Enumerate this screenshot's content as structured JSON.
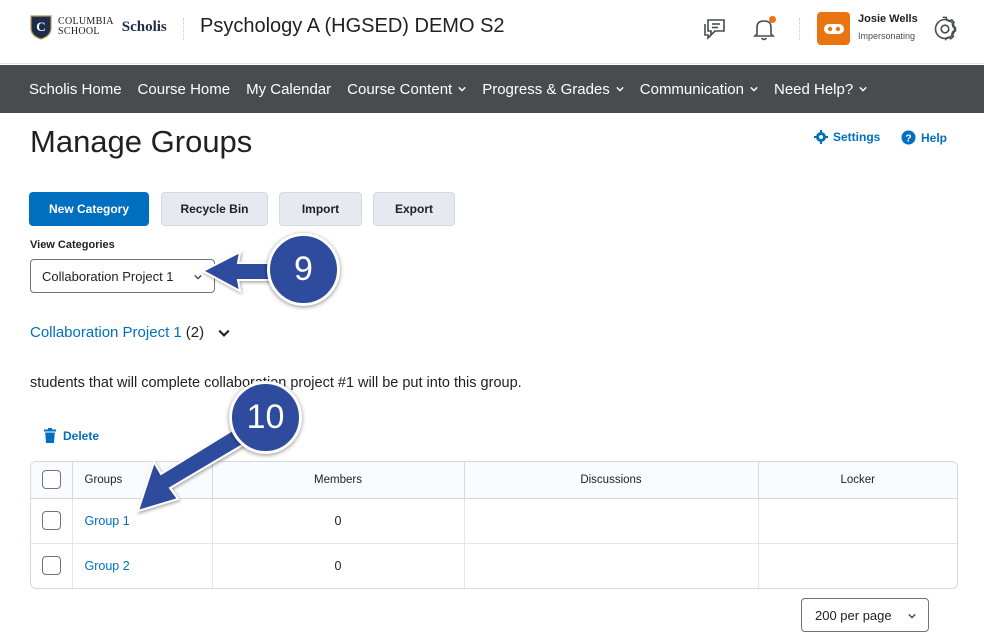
{
  "header": {
    "logo_line1": "COLUMBIA",
    "logo_line2": "SCHOOL",
    "logo_brand": "Scholis",
    "course_title": "Psychology A (HGSED) DEMO S2",
    "user_name": "Josie Wells",
    "user_role": "Impersonating",
    "icons": [
      "message-alerts-icon",
      "notifications-bell-icon",
      "impersonation-mask-icon",
      "settings-gear-icon"
    ],
    "notification_dot_color": "#e87511"
  },
  "nav": {
    "items": [
      {
        "label": "Scholis Home",
        "dropdown": false
      },
      {
        "label": "Course Home",
        "dropdown": false
      },
      {
        "label": "My Calendar",
        "dropdown": false
      },
      {
        "label": "Course Content",
        "dropdown": true
      },
      {
        "label": "Progress & Grades",
        "dropdown": true
      },
      {
        "label": "Communication",
        "dropdown": true
      },
      {
        "label": "Need Help?",
        "dropdown": true
      }
    ]
  },
  "page": {
    "title": "Manage Groups",
    "settings_label": "Settings",
    "help_label": "Help"
  },
  "buttons": {
    "new_category": "New Category",
    "recycle_bin": "Recycle Bin",
    "import": "Import",
    "export": "Export"
  },
  "view_categories": {
    "label": "View Categories",
    "selected": "Collaboration Project 1"
  },
  "category": {
    "name": "Collaboration Project 1",
    "count": "(2)",
    "description": "students that will complete collaboration project #1 will be put into this group."
  },
  "actions": {
    "delete_label": "Delete"
  },
  "table": {
    "columns": [
      "Groups",
      "Members",
      "Discussions",
      "Locker"
    ],
    "rows": [
      {
        "group": "Group 1",
        "members": "0",
        "discussions": "",
        "locker": ""
      },
      {
        "group": "Group 2",
        "members": "0",
        "discussions": "",
        "locker": ""
      }
    ]
  },
  "pagination": {
    "per_page": "200 per page"
  },
  "annotations": [
    {
      "number": "9"
    },
    {
      "number": "10"
    }
  ],
  "colors": {
    "accent": "#006fbf",
    "navbar": "#4a4b4d",
    "callout": "#2f4b9d",
    "orange": "#e87511"
  }
}
